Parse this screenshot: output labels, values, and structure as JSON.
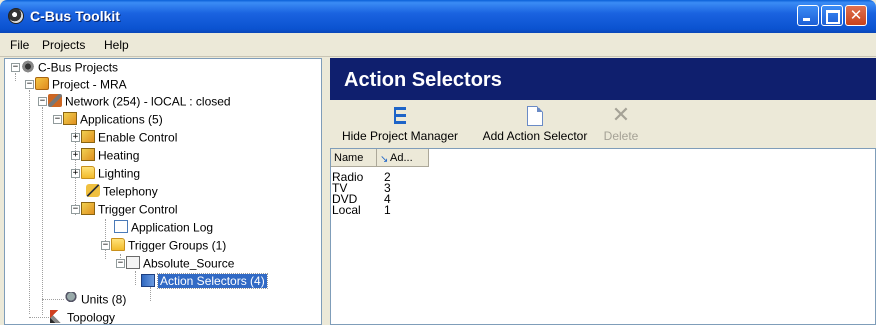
{
  "window": {
    "title": "C-Bus Toolkit",
    "icon": "cbus-logo-icon",
    "controls": [
      "minimize",
      "maximize",
      "close"
    ]
  },
  "menu": {
    "items": [
      {
        "label": "File",
        "underline": "F"
      },
      {
        "label": "Projects",
        "underline": "P"
      },
      {
        "label": "Help",
        "underline": "H"
      }
    ]
  },
  "tree": {
    "nodes": [
      {
        "label": "C-Bus Projects",
        "icon": "cbus-icon",
        "expanded": true
      },
      {
        "label": "Project - MRA",
        "icon": "project-icon",
        "expanded": true
      },
      {
        "label": "Network (254) - lOCAL : closed",
        "icon": "network-icon",
        "expanded": true
      },
      {
        "label": "Applications (5)",
        "icon": "applications-icon",
        "expanded": true
      },
      {
        "label": "Enable Control",
        "icon": "application-icon",
        "expanded": false
      },
      {
        "label": "Heating",
        "icon": "application-icon",
        "expanded": false
      },
      {
        "label": "Lighting",
        "icon": "folder-icon",
        "expanded": false
      },
      {
        "label": "Telephony",
        "icon": "telephony-icon"
      },
      {
        "label": "Trigger Control",
        "icon": "application-icon",
        "expanded": true
      },
      {
        "label": "Application Log",
        "icon": "log-icon"
      },
      {
        "label": "Trigger Groups (1)",
        "icon": "folder-icon",
        "expanded": true
      },
      {
        "label": "Absolute_Source",
        "icon": "document-icon",
        "expanded": true
      },
      {
        "label": "Action Selectors (4)",
        "icon": "action-selector-icon",
        "selected": true
      },
      {
        "label": "Units (8)",
        "icon": "units-icon"
      },
      {
        "label": "Topology",
        "icon": "topology-icon"
      }
    ]
  },
  "panel": {
    "title": "Action Selectors",
    "toolbar": {
      "hide_project_manager": "Hide Project Manager",
      "add_action_selector": "Add Action Selector",
      "delete": "Delete"
    },
    "columns": {
      "name": "Name",
      "address": "Ad..."
    },
    "rows": [
      {
        "name": "Radio",
        "address": "2"
      },
      {
        "name": "TV",
        "address": "3"
      },
      {
        "name": "DVD",
        "address": "4"
      },
      {
        "name": "Local",
        "address": "1"
      }
    ]
  },
  "colors": {
    "titlebar": "#0b52d0",
    "header": "#0f1f6e",
    "selection": "#316ac5",
    "window_bg": "#ece9d8"
  }
}
